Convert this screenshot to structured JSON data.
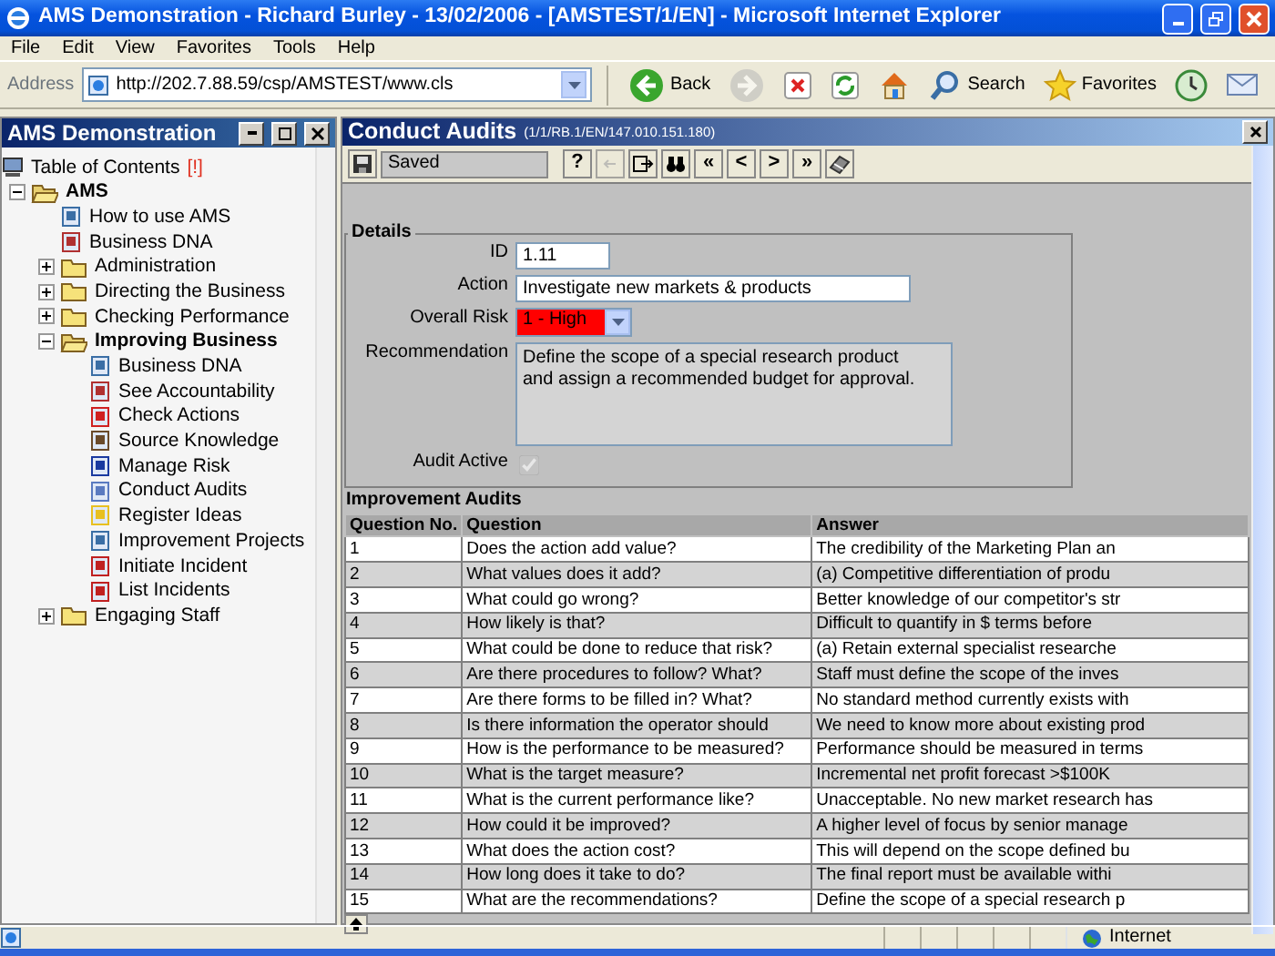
{
  "window": {
    "title": "AMS Demonstration - Richard Burley - 13/02/2006 - [AMSTEST/1/EN] - Microsoft Internet Explorer"
  },
  "menu": [
    "File",
    "Edit",
    "View",
    "Favorites",
    "Tools",
    "Help"
  ],
  "address": {
    "label": "Address",
    "value": "http://202.7.88.59/csp/AMSTEST/www.cls"
  },
  "browser_toolbar": [
    {
      "kind": "back",
      "label": "Back"
    },
    {
      "kind": "forward",
      "disabled": true
    },
    {
      "kind": "stop"
    },
    {
      "kind": "refresh"
    },
    {
      "kind": "home"
    },
    {
      "kind": "search",
      "label": "Search"
    },
    {
      "kind": "favorites",
      "label": "Favorites"
    },
    {
      "kind": "history"
    },
    {
      "kind": "mail"
    }
  ],
  "sidebar": {
    "title": "AMS Demonstration",
    "toc_label": "Table of Contents",
    "toc_flag": "[!]",
    "tree": [
      {
        "label": "AMS",
        "kind": "folder",
        "expanded": true,
        "children": [
          {
            "label": "How to use AMS",
            "kind": "page"
          },
          {
            "label": "Business DNA",
            "kind": "page"
          },
          {
            "label": "Administration",
            "kind": "folder",
            "expanded": false
          },
          {
            "label": "Directing the Business",
            "kind": "folder",
            "expanded": false
          },
          {
            "label": "Checking Performance",
            "kind": "folder",
            "expanded": false
          },
          {
            "label": "Improving Business",
            "kind": "folder",
            "expanded": true,
            "children": [
              {
                "label": "Business DNA",
                "kind": "page"
              },
              {
                "label": "See Accountability",
                "kind": "page"
              },
              {
                "label": "Check Actions",
                "kind": "page"
              },
              {
                "label": "Source Knowledge",
                "kind": "page"
              },
              {
                "label": "Manage Risk",
                "kind": "page"
              },
              {
                "label": "Conduct Audits",
                "kind": "page"
              },
              {
                "label": "Register Ideas",
                "kind": "page"
              },
              {
                "label": "Improvement Projects",
                "kind": "page"
              },
              {
                "label": "Initiate Incident",
                "kind": "page"
              },
              {
                "label": "List Incidents",
                "kind": "page"
              }
            ]
          },
          {
            "label": "Engaging Staff",
            "kind": "folder",
            "expanded": false
          }
        ]
      }
    ]
  },
  "panel": {
    "title": "Conduct Audits",
    "subtitle": "(1/1/RB.1/EN/147.010.151.180)",
    "toolbar": [
      {
        "kind": "save"
      },
      {
        "kind": "status",
        "text": "Saved"
      },
      {
        "kind": "glyph",
        "text": "?"
      },
      {
        "kind": "undo",
        "disabled": true
      },
      {
        "kind": "exit"
      },
      {
        "kind": "find"
      },
      {
        "kind": "glyph",
        "text": "«"
      },
      {
        "kind": "glyph",
        "text": "<"
      },
      {
        "kind": "glyph",
        "text": ">"
      },
      {
        "kind": "glyph",
        "text": "»"
      },
      {
        "kind": "clear"
      }
    ],
    "details": {
      "legend": "Details",
      "fields": [
        {
          "kind": "text",
          "label": "ID",
          "value": "1.11"
        },
        {
          "kind": "text",
          "label": "Action",
          "value": "Investigate new markets & products"
        },
        {
          "kind": "select",
          "label": "Overall Risk",
          "value": "1 - High",
          "color": "#ff0000"
        },
        {
          "kind": "textarea",
          "label": "Recommendation",
          "value": "Define the scope of a special research product and assign a recommended budget for approval."
        },
        {
          "kind": "checkbox",
          "label": "Audit Active",
          "checked": true,
          "disabled": true
        }
      ]
    },
    "audits": {
      "title": "Improvement Audits",
      "columns": [
        "Question No.",
        "Question",
        "Answer"
      ],
      "rows": [
        [
          "1",
          "Does the action add value?",
          "The credibility of the Marketing Plan an"
        ],
        [
          "2",
          "What values does it add?",
          "(a) Competitive differentiation of produ"
        ],
        [
          "3",
          "What could go wrong?",
          "Better knowledge of our competitor's str"
        ],
        [
          "4",
          "How likely is that?",
          "Difficult to quantify in $ terms before"
        ],
        [
          "5",
          "What could be done to reduce that risk?",
          "(a) Retain external specialist researche"
        ],
        [
          "6",
          "Are there procedures to follow? What?",
          "Staff must define the scope of the inves"
        ],
        [
          "7",
          "Are there forms to be filled in? What?",
          "No standard method currently exists with"
        ],
        [
          "8",
          "Is there information the operator should",
          "We need to know more about existing prod"
        ],
        [
          "9",
          "How is the performance to be measured?",
          "Performance should be measured in terms"
        ],
        [
          "10",
          "What is the target measure?",
          "Incremental net profit forecast >$100K"
        ],
        [
          "11",
          "What is the current performance like?",
          "Unacceptable. No new market research has"
        ],
        [
          "12",
          "How could it be improved?",
          "A higher level of focus by senior manage"
        ],
        [
          "13",
          "What does the action cost?",
          "This will depend on the scope defined bu"
        ],
        [
          "14",
          "How long does it take to do?",
          "The final report must be available withi"
        ],
        [
          "15",
          "What are the recommendations?",
          "Define the scope of a special research p"
        ]
      ]
    }
  },
  "status_bar": {
    "zone": "Internet"
  }
}
